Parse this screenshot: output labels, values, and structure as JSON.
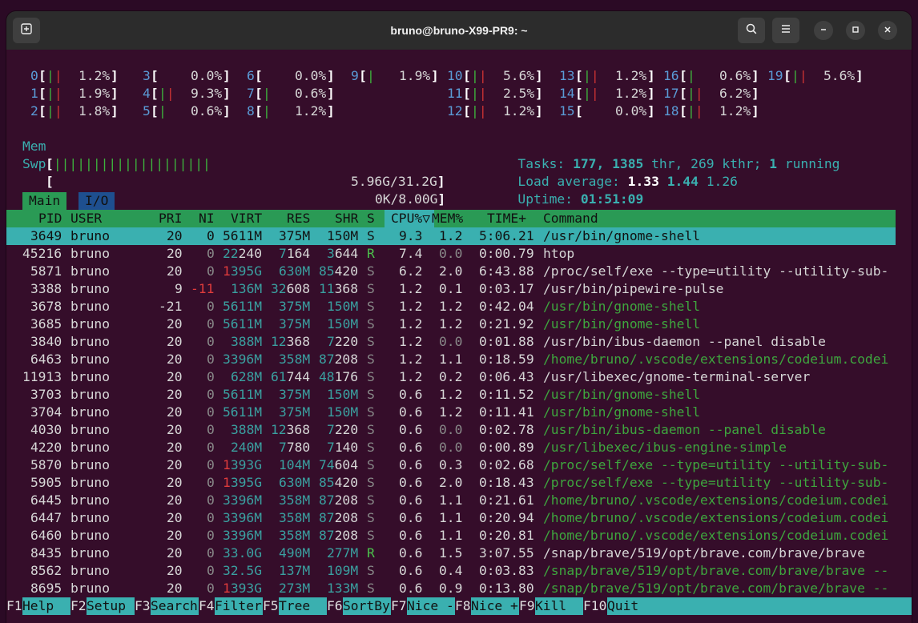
{
  "window": {
    "title": "bruno@bruno-X99-PR9: ~",
    "new_tab_icon": "new-tab-icon",
    "search_icon": "search-icon",
    "menu_icon": "hamburger-menu-icon",
    "minimize_icon": "minimize-icon",
    "maximize_icon": "maximize-icon",
    "close_icon": "close-icon"
  },
  "cpus": [
    {
      "id": "0",
      "bar": "||",
      "pct": "1.2%"
    },
    {
      "id": "1",
      "bar": "||",
      "pct": "1.9%"
    },
    {
      "id": "2",
      "bar": "||",
      "pct": "1.8%"
    },
    {
      "id": "3",
      "bar": "",
      "pct": "0.0%"
    },
    {
      "id": "4",
      "bar": "||",
      "pct": "9.3%"
    },
    {
      "id": "5",
      "bar": "|",
      "pct": "0.6%"
    },
    {
      "id": "6",
      "bar": "",
      "pct": "0.0%"
    },
    {
      "id": "7",
      "bar": "|",
      "pct": "0.6%"
    },
    {
      "id": "8",
      "bar": "|",
      "pct": "1.2%"
    },
    {
      "id": "9",
      "bar": "|",
      "pct": "1.9%"
    },
    {
      "id": "10",
      "bar": "||",
      "pct": "5.6%"
    },
    {
      "id": "11",
      "bar": "||",
      "pct": "2.5%"
    },
    {
      "id": "12",
      "bar": "||",
      "pct": "1.2%"
    },
    {
      "id": "13",
      "bar": "||",
      "pct": "1.2%"
    },
    {
      "id": "14",
      "bar": "||",
      "pct": "1.2%"
    },
    {
      "id": "15",
      "bar": "",
      "pct": "0.0%"
    },
    {
      "id": "16",
      "bar": "|",
      "pct": "0.6%"
    },
    {
      "id": "17",
      "bar": "||",
      "pct": "6.2%"
    },
    {
      "id": "18",
      "bar": "||",
      "pct": "1.2%"
    },
    {
      "id": "19",
      "bar": "||",
      "pct": "5.6%"
    }
  ],
  "mem": {
    "label": "Mem",
    "bar": "||||||||||||||||||||",
    "value": "5.96G/31.2G"
  },
  "swp": {
    "label": "Swp",
    "value": "0K/8.00G"
  },
  "tasks": {
    "label": "Tasks:",
    "count": "177,",
    "thr": "1385",
    "thr_label": "thr,",
    "kthr": "269 kthr;",
    "running": "1",
    "running_label": "running"
  },
  "load": {
    "label": "Load average:",
    "l1": "1.33",
    "l5": "1.44",
    "l15": "1.26"
  },
  "uptime": {
    "label": "Uptime:",
    "value": "01:51:09"
  },
  "tabs": {
    "main": "Main",
    "io": "I/O"
  },
  "columns": {
    "pid": "PID",
    "user": "USER",
    "pri": "PRI",
    "ni": "NI",
    "virt": "VIRT",
    "res": "RES",
    "shr": "SHR",
    "s": "S",
    "cpu": "CPU%▽",
    "mem": "MEM%",
    "time": "TIME+",
    "cmd": "Command"
  },
  "processes": [
    {
      "pid": "3649",
      "user": "bruno",
      "pri": "20",
      "ni": "0",
      "virt": "5611M",
      "res": "375M",
      "shr": "150M",
      "s": "S",
      "cpu": "9.3",
      "mem": "1.2",
      "time": "5:06.21",
      "cmd": "/usr/bin/gnome-shell",
      "thread": false,
      "selected": true
    },
    {
      "pid": "45216",
      "user": "bruno",
      "pri": "20",
      "ni": "0",
      "virt": "22240",
      "res": "7164",
      "shr": "3644",
      "s": "R",
      "cpu": "7.4",
      "mem": "0.0",
      "time": "0:00.79",
      "cmd": "htop",
      "thread": false,
      "selected": false
    },
    {
      "pid": "5871",
      "user": "bruno",
      "pri": "20",
      "ni": "0",
      "virt": "1395G",
      "res": "630M",
      "shr": "85420",
      "s": "S",
      "cpu": "6.2",
      "mem": "2.0",
      "time": "6:43.88",
      "cmd": "/proc/self/exe --type=utility --utility-sub-",
      "thread": false,
      "selected": false
    },
    {
      "pid": "3388",
      "user": "bruno",
      "pri": "9",
      "ni": "-11",
      "virt": "136M",
      "res": "32608",
      "shr": "11368",
      "s": "S",
      "cpu": "1.2",
      "mem": "0.1",
      "time": "0:03.17",
      "cmd": "/usr/bin/pipewire-pulse",
      "thread": false,
      "selected": false
    },
    {
      "pid": "3678",
      "user": "bruno",
      "pri": "-21",
      "ni": "0",
      "virt": "5611M",
      "res": "375M",
      "shr": "150M",
      "s": "S",
      "cpu": "1.2",
      "mem": "1.2",
      "time": "0:42.04",
      "cmd": "/usr/bin/gnome-shell",
      "thread": true,
      "selected": false
    },
    {
      "pid": "3685",
      "user": "bruno",
      "pri": "20",
      "ni": "0",
      "virt": "5611M",
      "res": "375M",
      "shr": "150M",
      "s": "S",
      "cpu": "1.2",
      "mem": "1.2",
      "time": "0:21.92",
      "cmd": "/usr/bin/gnome-shell",
      "thread": true,
      "selected": false
    },
    {
      "pid": "3840",
      "user": "bruno",
      "pri": "20",
      "ni": "0",
      "virt": "388M",
      "res": "12368",
      "shr": "7220",
      "s": "S",
      "cpu": "1.2",
      "mem": "0.0",
      "time": "0:01.88",
      "cmd": "/usr/bin/ibus-daemon --panel disable",
      "thread": false,
      "selected": false
    },
    {
      "pid": "6463",
      "user": "bruno",
      "pri": "20",
      "ni": "0",
      "virt": "3396M",
      "res": "358M",
      "shr": "87208",
      "s": "S",
      "cpu": "1.2",
      "mem": "1.1",
      "time": "0:18.59",
      "cmd": "/home/bruno/.vscode/extensions/codeium.codei",
      "thread": true,
      "selected": false
    },
    {
      "pid": "11913",
      "user": "bruno",
      "pri": "20",
      "ni": "0",
      "virt": "628M",
      "res": "61744",
      "shr": "48176",
      "s": "S",
      "cpu": "1.2",
      "mem": "0.2",
      "time": "0:06.43",
      "cmd": "/usr/libexec/gnome-terminal-server",
      "thread": false,
      "selected": false
    },
    {
      "pid": "3703",
      "user": "bruno",
      "pri": "20",
      "ni": "0",
      "virt": "5611M",
      "res": "375M",
      "shr": "150M",
      "s": "S",
      "cpu": "0.6",
      "mem": "1.2",
      "time": "0:11.52",
      "cmd": "/usr/bin/gnome-shell",
      "thread": true,
      "selected": false
    },
    {
      "pid": "3704",
      "user": "bruno",
      "pri": "20",
      "ni": "0",
      "virt": "5611M",
      "res": "375M",
      "shr": "150M",
      "s": "S",
      "cpu": "0.6",
      "mem": "1.2",
      "time": "0:11.41",
      "cmd": "/usr/bin/gnome-shell",
      "thread": true,
      "selected": false
    },
    {
      "pid": "4030",
      "user": "bruno",
      "pri": "20",
      "ni": "0",
      "virt": "388M",
      "res": "12368",
      "shr": "7220",
      "s": "S",
      "cpu": "0.6",
      "mem": "0.0",
      "time": "0:02.78",
      "cmd": "/usr/bin/ibus-daemon --panel disable",
      "thread": true,
      "selected": false
    },
    {
      "pid": "4220",
      "user": "bruno",
      "pri": "20",
      "ni": "0",
      "virt": "240M",
      "res": "7780",
      "shr": "7140",
      "s": "S",
      "cpu": "0.6",
      "mem": "0.0",
      "time": "0:00.89",
      "cmd": "/usr/libexec/ibus-engine-simple",
      "thread": true,
      "selected": false
    },
    {
      "pid": "5870",
      "user": "bruno",
      "pri": "20",
      "ni": "0",
      "virt": "1393G",
      "res": "104M",
      "shr": "74604",
      "s": "S",
      "cpu": "0.6",
      "mem": "0.3",
      "time": "0:02.68",
      "cmd": "/proc/self/exe --type=utility --utility-sub-",
      "thread": true,
      "selected": false
    },
    {
      "pid": "5905",
      "user": "bruno",
      "pri": "20",
      "ni": "0",
      "virt": "1395G",
      "res": "630M",
      "shr": "85420",
      "s": "S",
      "cpu": "0.6",
      "mem": "2.0",
      "time": "0:18.43",
      "cmd": "/proc/self/exe --type=utility --utility-sub-",
      "thread": true,
      "selected": false
    },
    {
      "pid": "6445",
      "user": "bruno",
      "pri": "20",
      "ni": "0",
      "virt": "3396M",
      "res": "358M",
      "shr": "87208",
      "s": "S",
      "cpu": "0.6",
      "mem": "1.1",
      "time": "0:21.61",
      "cmd": "/home/bruno/.vscode/extensions/codeium.codei",
      "thread": true,
      "selected": false
    },
    {
      "pid": "6447",
      "user": "bruno",
      "pri": "20",
      "ni": "0",
      "virt": "3396M",
      "res": "358M",
      "shr": "87208",
      "s": "S",
      "cpu": "0.6",
      "mem": "1.1",
      "time": "0:20.94",
      "cmd": "/home/bruno/.vscode/extensions/codeium.codei",
      "thread": true,
      "selected": false
    },
    {
      "pid": "6460",
      "user": "bruno",
      "pri": "20",
      "ni": "0",
      "virt": "3396M",
      "res": "358M",
      "shr": "87208",
      "s": "S",
      "cpu": "0.6",
      "mem": "1.1",
      "time": "0:20.81",
      "cmd": "/home/bruno/.vscode/extensions/codeium.codei",
      "thread": true,
      "selected": false
    },
    {
      "pid": "8435",
      "user": "bruno",
      "pri": "20",
      "ni": "0",
      "virt": "33.0G",
      "res": "490M",
      "shr": "277M",
      "s": "R",
      "cpu": "0.6",
      "mem": "1.5",
      "time": "3:07.55",
      "cmd": "/snap/brave/519/opt/brave.com/brave/brave",
      "thread": false,
      "selected": false
    },
    {
      "pid": "8562",
      "user": "bruno",
      "pri": "20",
      "ni": "0",
      "virt": "32.5G",
      "res": "137M",
      "shr": "109M",
      "s": "S",
      "cpu": "0.6",
      "mem": "0.4",
      "time": "0:03.83",
      "cmd": "/snap/brave/519/opt/brave.com/brave/brave --",
      "thread": true,
      "selected": false
    },
    {
      "pid": "8695",
      "user": "bruno",
      "pri": "20",
      "ni": "0",
      "virt": "1393G",
      "res": "273M",
      "shr": "133M",
      "s": "S",
      "cpu": "0.6",
      "mem": "0.9",
      "time": "0:13.80",
      "cmd": "/snap/brave/519/opt/brave.com/brave/brave --",
      "thread": true,
      "selected": false
    }
  ],
  "fkeys": [
    {
      "key": "F1",
      "label": "Help  "
    },
    {
      "key": "F2",
      "label": "Setup "
    },
    {
      "key": "F3",
      "label": "Search"
    },
    {
      "key": "F4",
      "label": "Filter"
    },
    {
      "key": "F5",
      "label": "Tree  "
    },
    {
      "key": "F6",
      "label": "SortBy"
    },
    {
      "key": "F7",
      "label": "Nice -"
    },
    {
      "key": "F8",
      "label": "Nice +"
    },
    {
      "key": "F9",
      "label": "Kill  "
    },
    {
      "key": "F10",
      "label": "Quit  "
    }
  ]
}
